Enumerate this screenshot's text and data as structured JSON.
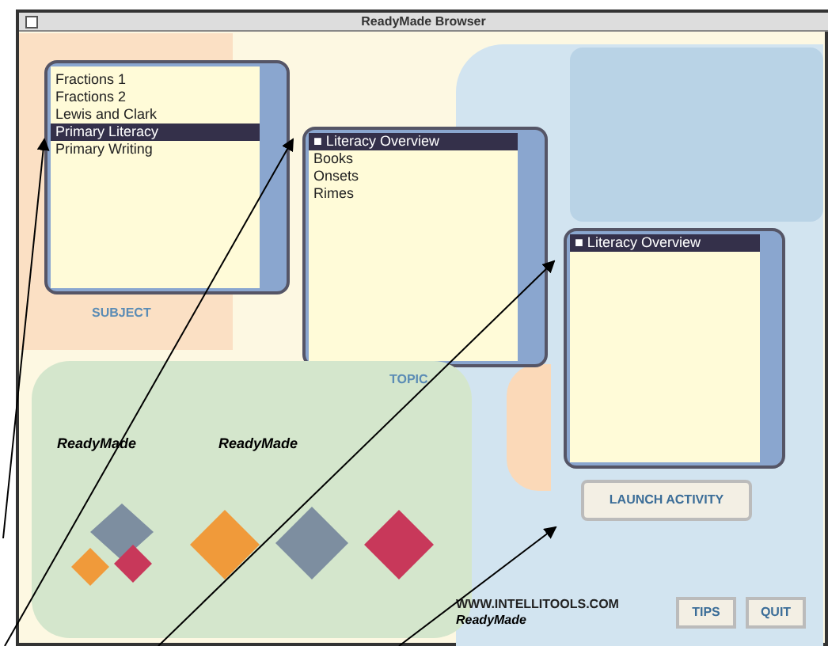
{
  "window": {
    "title": "ReadyMade Browser"
  },
  "subject": {
    "label": "SUBJECT",
    "items": [
      {
        "text": "Fractions 1",
        "selected": false
      },
      {
        "text": "Fractions 2",
        "selected": false
      },
      {
        "text": "Lewis and Clark",
        "selected": false
      },
      {
        "text": "Primary Literacy",
        "selected": true
      },
      {
        "text": "Primary Writing",
        "selected": false
      }
    ]
  },
  "topic": {
    "label": "TOPIC",
    "items": [
      {
        "text": "■ Literacy Overview",
        "selected": true
      },
      {
        "text": "Books",
        "selected": false
      },
      {
        "text": "Onsets",
        "selected": false
      },
      {
        "text": "Rimes",
        "selected": false
      }
    ]
  },
  "activity": {
    "items": [
      {
        "text": "■ Literacy Overview",
        "selected": true
      }
    ]
  },
  "launch_button": "LAUNCH ACTIVITY",
  "logos": [
    "ReadyMade",
    "ReadyMade"
  ],
  "footer": {
    "url": "WWW.INTELLITOOLS.COM",
    "brand": "ReadyMade"
  },
  "buttons": [
    "TIPS",
    "QUIT"
  ]
}
